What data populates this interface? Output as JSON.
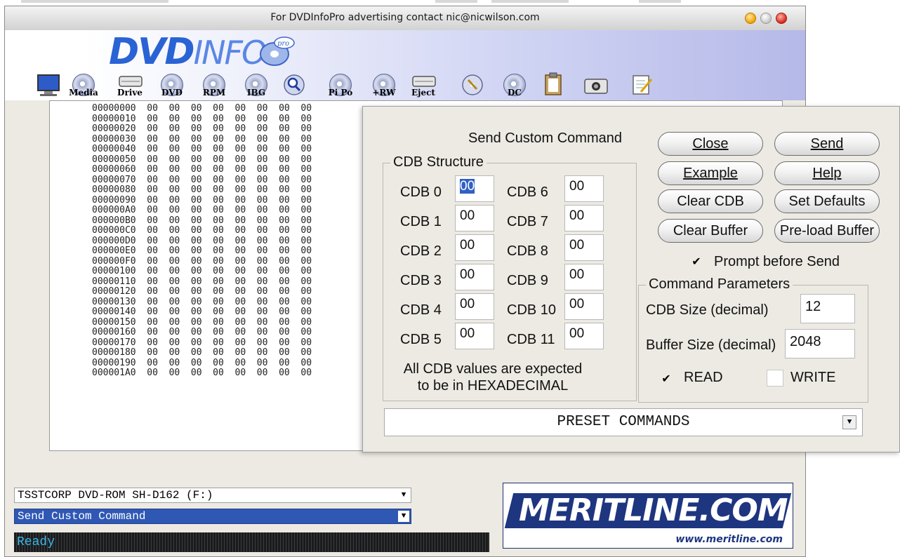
{
  "window": {
    "title": "For DVDInfoPro advertising contact nic@nicwilson.com"
  },
  "logo": {
    "part1": "DVD",
    "part2": "INFO",
    "badge": "pro"
  },
  "toolbar": {
    "items": [
      {
        "icon": "monitor-icon",
        "label": ""
      },
      {
        "icon": "disc-icon",
        "label": "Media"
      },
      {
        "icon": "drive-icon",
        "label": "Drive"
      },
      {
        "icon": "disc-icon",
        "label": "DVD"
      },
      {
        "icon": "disc-icon",
        "label": "RPM"
      },
      {
        "icon": "disc-icon",
        "label": "IBG"
      },
      {
        "icon": "magnifier-icon",
        "label": ""
      },
      {
        "icon": "disc-icon",
        "label": "Pi Po"
      },
      {
        "icon": "disc-icon",
        "label": "+RW"
      },
      {
        "icon": "drive-icon",
        "label": "Eject"
      },
      {
        "icon": "disc-icon",
        "label": ""
      },
      {
        "icon": "disc-icon",
        "label": "DC"
      },
      {
        "icon": "clipboard-icon",
        "label": ""
      },
      {
        "icon": "camera-icon",
        "label": ""
      },
      {
        "icon": "notepad-icon",
        "label": ""
      }
    ]
  },
  "hexdump": {
    "lines": [
      "00000000  00  00  00  00  00  00  00  00",
      "00000010  00  00  00  00  00  00  00  00",
      "00000020  00  00  00  00  00  00  00  00",
      "00000030  00  00  00  00  00  00  00  00",
      "00000040  00  00  00  00  00  00  00  00",
      "00000050  00  00  00  00  00  00  00  00",
      "00000060  00  00  00  00  00  00  00  00",
      "00000070  00  00  00  00  00  00  00  00",
      "00000080  00  00  00  00  00  00  00  00",
      "00000090  00  00  00  00  00  00  00  00",
      "000000A0  00  00  00  00  00  00  00  00",
      "000000B0  00  00  00  00  00  00  00  00",
      "000000C0  00  00  00  00  00  00  00  00",
      "000000D0  00  00  00  00  00  00  00  00",
      "000000E0  00  00  00  00  00  00  00  00",
      "000000F0  00  00  00  00  00  00  00  00",
      "00000100  00  00  00  00  00  00  00  00",
      "00000110  00  00  00  00  00  00  00  00",
      "00000120  00  00  00  00  00  00  00  00",
      "00000130  00  00  00  00  00  00  00  00",
      "00000140  00  00  00  00  00  00  00  00",
      "00000150  00  00  00  00  00  00  00  00",
      "00000160  00  00  00  00  00  00  00  00",
      "00000170  00  00  00  00  00  00  00  00",
      "00000180  00  00  00  00  00  00  00  00",
      "00000190  00  00  00  00  00  00  00  00",
      "000001A0  00  00  00  00  00  00  00  00"
    ]
  },
  "drive_select": {
    "value": "TSSTCORP DVD-ROM SH-D162 (F:)"
  },
  "function_select": {
    "value": "Send Custom Command"
  },
  "status": {
    "text": "Ready"
  },
  "ad": {
    "brand": "MERITLINE.COM",
    "url": "www.meritline.com"
  },
  "dialog": {
    "title": "Send Custom Command",
    "cdb_group_label": "CDB Structure",
    "cdb": [
      {
        "label": "CDB 0",
        "value": "00"
      },
      {
        "label": "CDB 1",
        "value": "00"
      },
      {
        "label": "CDB 2",
        "value": "00"
      },
      {
        "label": "CDB 3",
        "value": "00"
      },
      {
        "label": "CDB 4",
        "value": "00"
      },
      {
        "label": "CDB 5",
        "value": "00"
      },
      {
        "label": "CDB 6",
        "value": "00"
      },
      {
        "label": "CDB 7",
        "value": "00"
      },
      {
        "label": "CDB 8",
        "value": "00"
      },
      {
        "label": "CDB 9",
        "value": "00"
      },
      {
        "label": "CDB 10",
        "value": "00"
      },
      {
        "label": "CDB 11",
        "value": "00"
      }
    ],
    "note_line1": "All CDB values are expected",
    "note_line2": "to be in HEXADECIMAL",
    "buttons": {
      "close": "Close",
      "send": "Send",
      "example": "Example",
      "help": "Help",
      "clear_cdb": "Clear CDB",
      "set_defaults": "Set Defaults",
      "clear_buffer": "Clear Buffer",
      "preload_buffer": "Pre-load Buffer"
    },
    "prompt_before_send": {
      "label": "Prompt before Send",
      "checked": true
    },
    "params_label": "Command Parameters",
    "cdb_size_label": "CDB Size (decimal)",
    "cdb_size_value": "12",
    "buffer_size_label": "Buffer Size (decimal)",
    "buffer_size_value": "2048",
    "read": {
      "label": "READ",
      "checked": true
    },
    "write": {
      "label": "WRITE",
      "checked": false
    },
    "preset": "PRESET COMMANDS"
  }
}
